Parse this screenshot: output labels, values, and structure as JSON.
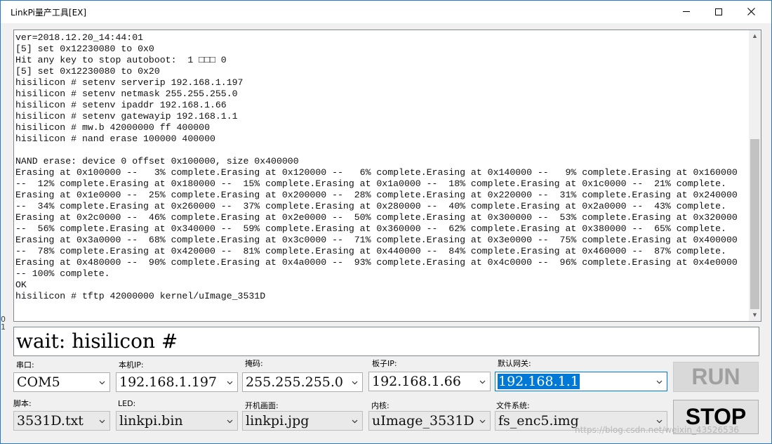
{
  "window": {
    "title": "LinkPi量产工具[EX]",
    "controls": {
      "minimize": "minimize",
      "maximize": "maximize",
      "close": "close"
    }
  },
  "console": {
    "lines": [
      "ver=2018.12.20_14:44:01",
      "[5] set 0x12230080 to 0x0",
      "Hit any key to stop autoboot:  1 □□□ 0",
      "[5] set 0x12230080 to 0x20",
      "hisilicon # setenv serverip 192.168.1.197",
      "hisilicon # setenv netmask 255.255.255.0",
      "hisilicon # setenv ipaddr 192.168.1.66",
      "hisilicon # setenv gatewayip 192.168.1.1",
      "hisilicon # mw.b 42000000 ff 400000",
      "hisilicon # nand erase 100000 400000",
      "",
      "NAND erase: device 0 offset 0x100000, size 0x400000",
      "Erasing at 0x100000 --   3% complete.Erasing at 0x120000 --   6% complete.Erasing at 0x140000 --   9% complete.Erasing at 0x160000",
      "--  12% complete.Erasing at 0x180000 --  15% complete.Erasing at 0x1a0000 --  18% complete.Erasing at 0x1c0000 --  21% complete.",
      "Erasing at 0x1e0000 --  25% complete.Erasing at 0x200000 --  28% complete.Erasing at 0x220000 --  31% complete.Erasing at 0x240000",
      "--  34% complete.Erasing at 0x260000 --  37% complete.Erasing at 0x280000 --  40% complete.Erasing at 0x2a0000 --  43% complete.",
      "Erasing at 0x2c0000 --  46% complete.Erasing at 0x2e0000 --  50% complete.Erasing at 0x300000 --  53% complete.Erasing at 0x320000",
      "--  56% complete.Erasing at 0x340000 --  59% complete.Erasing at 0x360000 --  62% complete.Erasing at 0x380000 --  65% complete.",
      "Erasing at 0x3a0000 --  68% complete.Erasing at 0x3c0000 --  71% complete.Erasing at 0x3e0000 --  75% complete.Erasing at 0x400000",
      "--  78% complete.Erasing at 0x420000 --  81% complete.Erasing at 0x440000 --  84% complete.Erasing at 0x460000 --  87% complete.",
      "Erasing at 0x480000 --  90% complete.Erasing at 0x4a0000 --  93% complete.Erasing at 0x4c0000 --  96% complete.Erasing at 0x4e0000",
      "-- 100% complete.",
      "OK",
      "hisilicon # tftp 42000000 kernel/uImage_3531D"
    ],
    "scroll_up": "▲",
    "scroll_down": "▼"
  },
  "side_marks": {
    "text": "0\n1"
  },
  "status": {
    "text": "wait: hisilicon #"
  },
  "fields": {
    "serial": {
      "label": "串口:",
      "value": "COM5"
    },
    "local_ip": {
      "label": "本机IP:",
      "value": "192.168.1.197"
    },
    "netmask": {
      "label": "掩码:",
      "value": "255.255.255.0"
    },
    "board_ip": {
      "label": "板子IP:",
      "value": "192.168.1.66"
    },
    "gateway": {
      "label": "默认网关:",
      "value": "192.168.1.1"
    },
    "script": {
      "label": "脚本:",
      "value": "3531D.txt"
    },
    "led": {
      "label": "LED:",
      "value": "linkpi.bin"
    },
    "boot_image": {
      "label": "开机画面:",
      "value": "linkpi.jpg"
    },
    "kernel": {
      "label": "内核:",
      "value": "uImage_3531D"
    },
    "filesystem": {
      "label": "文件系统:",
      "value": "fs_enc5.img"
    }
  },
  "buttons": {
    "run": "RUN",
    "stop": "STOP"
  },
  "watermark": {
    "text": "https://blog.csdn.net/weixin_43526536"
  },
  "colors": {
    "selection": "#0078d7",
    "window_bg": "#f0f0f0",
    "border": "#828790"
  }
}
